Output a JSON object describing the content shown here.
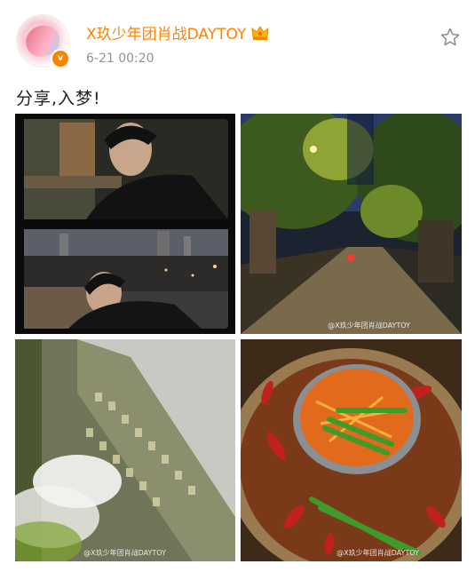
{
  "header": {
    "username": "X玖少年团肖战DAYTOY",
    "timestamp": "6-21 00:20",
    "verified_badge": "v"
  },
  "post": {
    "text": "分享,入梦!"
  },
  "images": [
    {
      "name": "photo-balcony-portraits"
    },
    {
      "name": "photo-night-street",
      "watermark": "@X玖少年团肖战DAYTOY"
    },
    {
      "name": "photo-building",
      "watermark": "@X玖少年团肖战DAYTOY"
    },
    {
      "name": "photo-hotpot",
      "watermark": "@X玖少年团肖战DAYTOY"
    }
  ],
  "icons": {
    "crown": "crown-icon",
    "favorite": "star-outline-icon",
    "verified": "verified-badge-icon"
  },
  "colors": {
    "username": "#ff8200",
    "timestamp": "#939393",
    "badge": "#ff8200"
  }
}
